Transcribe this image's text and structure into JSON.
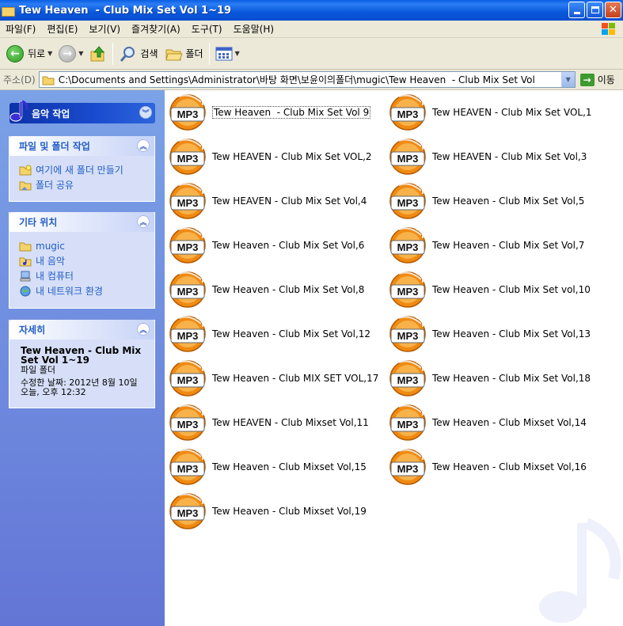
{
  "window": {
    "title": "Tew Heaven  - Club Mix Set Vol 1~19"
  },
  "menu": [
    "파일(F)",
    "편집(E)",
    "보기(V)",
    "즐겨찾기(A)",
    "도구(T)",
    "도움말(H)"
  ],
  "toolbar": {
    "back_label": "뒤로",
    "search_label": "검색",
    "folders_label": "폴더"
  },
  "address": {
    "label": "주소(D)",
    "path": "C:\\Documents and Settings\\Administrator\\바탕 화면\\보윤이의폴더\\mugic\\Tew Heaven  - Club Mix Set Vol",
    "go_label": "이동"
  },
  "sidebar": {
    "music_tasks": "음악 작업",
    "file_tasks": {
      "title": "파일 및 폴더 작업",
      "items": [
        "여기에 새 폴더 만들기",
        "폴더 공유"
      ]
    },
    "other_places": {
      "title": "기타 위치",
      "items": [
        "mugic",
        "내 음악",
        "내 컴퓨터",
        "내 네트워크 환경"
      ]
    },
    "details": {
      "title": "자세히",
      "name": "Tew Heaven  - Club Mix Set Vol 1~19",
      "type": "파일 폴더",
      "modified": "수정한 날짜: 2012년 8월 10일 오늘, 오후 12:32"
    }
  },
  "files": [
    "Tew Heaven  - Club Mix Set Vol 9",
    "Tew HEAVEN - Club Mix Set VOL,1",
    "Tew HEAVEN - Club Mix Set VOL,2",
    "Tew HEAVEN - Club Mix Set Vol,3",
    "Tew HEAVEN - Club Mix Set Vol,4",
    "Tew Heaven - Club Mix Set Vol,5",
    "Tew Heaven - Club Mix Set Vol,6",
    "Tew Heaven - Club Mix Set Vol,7",
    "Tew Heaven - Club Mix Set Vol,8",
    "Tew Heaven - Club Mix Set vol,10",
    "Tew Heaven - Club Mix Set Vol,12",
    "Tew Heaven - Club Mix Set Vol,13",
    "Tew Heaven - Club MIX SET VOL,17",
    "Tew Heaven - Club Mix Set Vol,18",
    "Tew HEAVEN - Club Mixset Vol,11",
    "Tew Heaven - Club Mixset Vol,14",
    "Tew Heaven - Club Mixset Vol,15",
    "Tew Heaven - Club Mixset Vol,16",
    "Tew Heaven - Club Mixset Vol,19"
  ],
  "file_icon_label": "MP3",
  "colors": {
    "titlebar": "#0a5fe3",
    "sidebar_top": "#7ba2e7",
    "sidebar_bottom": "#6375d6",
    "link": "#215dc6",
    "mp3_orange": "#f39a1a"
  }
}
